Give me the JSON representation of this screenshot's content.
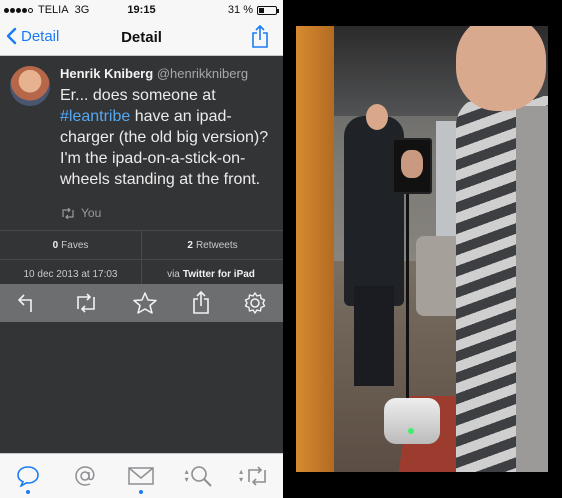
{
  "status_bar": {
    "carrier": "TELIA",
    "network": "3G",
    "time": "19:15",
    "battery": "31 %",
    "battery_level": 0.31
  },
  "nav": {
    "back_label": "Detail",
    "title": "Detail",
    "share_icon": "share-icon"
  },
  "tweet": {
    "author_name": "Henrik Kniberg",
    "author_handle": "@henrikkniberg",
    "text_parts": {
      "before": "Er... does someone at ",
      "hashtag": "#leantribe",
      "after": " have an ipad-charger (the old big version)? I'm the ipad-on-a-stick-on-wheels standing at the front."
    },
    "retweeted_by": "You"
  },
  "stats": {
    "faves_count": "0",
    "faves_label": "Faves",
    "retweets_count": "2",
    "retweets_label": "Retweets",
    "date": "10 dec 2013 at 17:03",
    "via_prefix": "via",
    "via_app": "Twitter for iPad"
  },
  "actions": [
    "reply-icon",
    "retweet-icon",
    "favorite-icon",
    "share-icon",
    "settings-icon"
  ],
  "tabs": [
    {
      "icon": "chat-bubble-icon",
      "active_dot": true
    },
    {
      "icon": "at-sign-icon",
      "active_dot": false
    },
    {
      "icon": "mail-icon",
      "active_dot": true
    },
    {
      "icon": "search-icon",
      "active_dot": false
    },
    {
      "icon": "retweet-icon",
      "active_dot": false
    }
  ],
  "colors": {
    "accent": "#1a7cf5",
    "link": "#55a8f4",
    "background": "#333436",
    "action_bar": "#6d6e70"
  }
}
